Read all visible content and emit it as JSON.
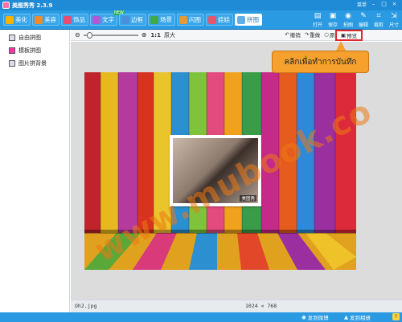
{
  "window": {
    "title": "美图秀秀 2.3.9",
    "menu_label": "菜单",
    "help_label": "帮助"
  },
  "tabs": [
    {
      "label": "美化",
      "icon": "beautify-icon",
      "color": "#f4b300"
    },
    {
      "label": "美容",
      "icon": "face-icon",
      "color": "#f08b2a"
    },
    {
      "label": "饰品",
      "icon": "heart-icon",
      "color": "#e84b74"
    },
    {
      "label": "文字",
      "icon": "text-icon",
      "color": "#b05ad1",
      "badge": "NEW"
    },
    {
      "label": "边框",
      "icon": "frame-icon",
      "color": "#4c8fd9"
    },
    {
      "label": "场景",
      "icon": "scene-icon",
      "color": "#3fa84b"
    },
    {
      "label": "闪图",
      "icon": "flash-icon",
      "color": "#e89a2e"
    },
    {
      "label": "娃娃",
      "icon": "doll-icon",
      "color": "#e4576b"
    },
    {
      "label": "拼图",
      "icon": "puzzle-icon",
      "color": "#5fb0e8",
      "active": true
    }
  ],
  "right_tools": [
    {
      "label": "打开",
      "icon": "folder-icon"
    },
    {
      "label": "保存",
      "icon": "save-icon"
    },
    {
      "label": "拍图",
      "icon": "camera-icon"
    },
    {
      "label": "编辑",
      "icon": "edit-icon"
    },
    {
      "label": "裁剪",
      "icon": "crop-icon"
    },
    {
      "label": "尺寸",
      "icon": "size-icon"
    }
  ],
  "left_panel": {
    "items": [
      {
        "label": "自由拼图",
        "icon": "free-collage-icon"
      },
      {
        "label": "模板拼图",
        "icon": "template-collage-icon"
      },
      {
        "label": "图片拼背景",
        "icon": "background-collage-icon"
      }
    ]
  },
  "edit_bar": {
    "zoom_ratio": "1:1",
    "original_label": "原大",
    "undo_label": "撤销",
    "redo_label": "重做",
    "original_image_label": "原图",
    "compare_label": "对比",
    "preview_label": "预览"
  },
  "canvas": {
    "watermark_text": "www.mubook.co",
    "inner_label": "美图秀",
    "callout_text": "คลิกเพื่อทำการบันทึก"
  },
  "info_bar": {
    "filename": "Oh2.jpg",
    "dimensions": "1024 × 768"
  },
  "status_bar": {
    "share_weibo": "发到微博",
    "share_album": "发到相册"
  },
  "colors": {
    "titlebar": "#1f8bd6",
    "toolbar": "#2a9be3",
    "callout": "#f6a12d",
    "highlight": "#e2262c"
  }
}
